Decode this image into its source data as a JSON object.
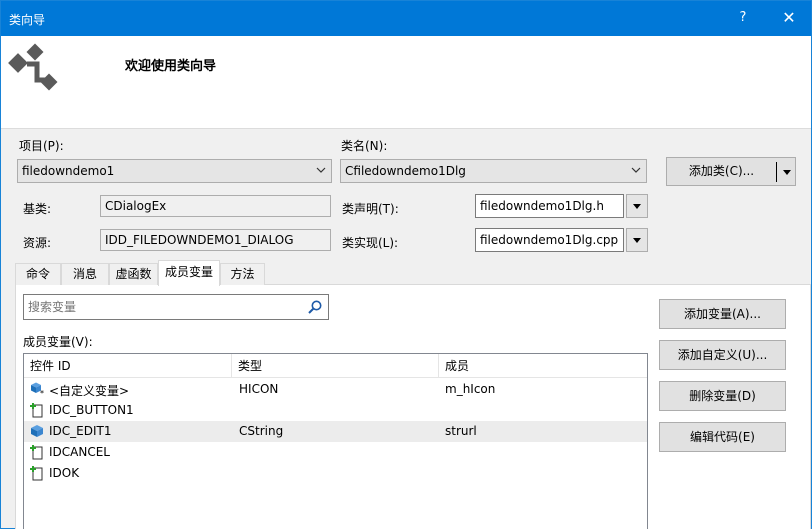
{
  "window": {
    "title": "类向导",
    "help_label": "?",
    "close_label": "✕"
  },
  "header": {
    "welcome": "欢迎使用类向导"
  },
  "project": {
    "label": "项目(P):",
    "value": "filedowndemo1"
  },
  "classname": {
    "label": "类名(N):",
    "value": "Cfiledowndemo1Dlg"
  },
  "add_class_button": {
    "label": "添加类(C)..."
  },
  "base_class": {
    "label": "基类:",
    "value": "CDialogEx"
  },
  "class_decl": {
    "label": "类声明(T):",
    "value": "filedowndemo1Dlg.h"
  },
  "resource": {
    "label": "资源:",
    "value": "IDD_FILEDOWNDEMO1_DIALOG"
  },
  "class_impl": {
    "label": "类实现(L):",
    "value": "filedowndemo1Dlg.cpp"
  },
  "tabs": [
    {
      "label": "命令"
    },
    {
      "label": "消息"
    },
    {
      "label": "虚函数"
    },
    {
      "label": "成员变量"
    },
    {
      "label": "方法"
    }
  ],
  "active_tab": "成员变量",
  "search": {
    "placeholder": "搜索变量"
  },
  "members": {
    "label": "成员变量(V):",
    "columns": [
      "控件 ID",
      "类型",
      "成员"
    ],
    "rows": [
      {
        "id": "<自定义变量>",
        "type": "HICON",
        "member": "m_hIcon",
        "icon": "custom-variable-icon"
      },
      {
        "id": "IDC_BUTTON1",
        "type": "",
        "member": "",
        "icon": "control-id-icon"
      },
      {
        "id": "IDC_EDIT1",
        "type": "CString",
        "member": "strurl",
        "icon": "variable-icon"
      },
      {
        "id": "IDCANCEL",
        "type": "",
        "member": "",
        "icon": "control-id-icon"
      },
      {
        "id": "IDOK",
        "type": "",
        "member": "",
        "icon": "control-id-icon"
      }
    ]
  },
  "buttons": {
    "add_variable": "添加变量(A)...",
    "add_custom": "添加自定义(U)...",
    "delete_variable": "删除变量(D)",
    "edit_code": "编辑代码(E)"
  },
  "colors": {
    "titlebar": "#0078d7",
    "selected_row": "#ececec",
    "variable_icon": "#1e6fb8"
  }
}
